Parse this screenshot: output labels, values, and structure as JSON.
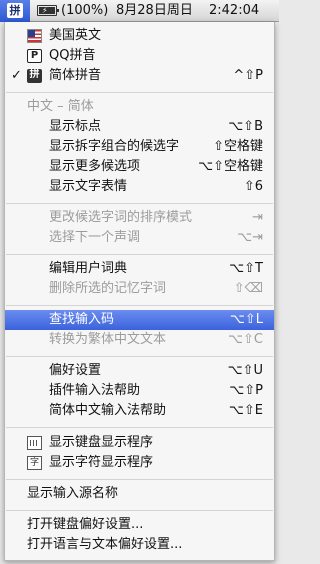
{
  "menubar": {
    "ime_glyph": "拼",
    "battery_glyph": "⚡",
    "battery": "(100%)",
    "date": "8月28日周日",
    "time": "2:42:04"
  },
  "menu": {
    "input_sources": [
      {
        "label": "美国英文",
        "icon": "us-flag-icon",
        "checked": false,
        "shortcut": ""
      },
      {
        "label": "QQ拼音",
        "icon": "p-box-icon",
        "icon_glyph": "P",
        "checked": false,
        "shortcut": ""
      },
      {
        "label": "简体拼音",
        "icon": "pinyin-icon",
        "icon_glyph": "拼",
        "checked": true,
        "check_glyph": "✓",
        "shortcut": "^⇧P"
      }
    ],
    "section_header": "中文 – 简体",
    "display_items": [
      {
        "label": "显示标点",
        "shortcut": "⌥⇧B"
      },
      {
        "label": "显示拆字组合的候选字",
        "shortcut": "⇧空格键"
      },
      {
        "label": "显示更多候选项",
        "shortcut": "⌥⇧空格键"
      },
      {
        "label": "显示文字表情",
        "shortcut": "⇧6"
      }
    ],
    "candidate_items": [
      {
        "label": "更改候选字词的排序模式",
        "shortcut": "⇥"
      },
      {
        "label": "选择下一个声调",
        "shortcut": "⌥⇥"
      }
    ],
    "dictionary_items": [
      {
        "label": "编辑用户词典",
        "shortcut": "⌥⇧T"
      },
      {
        "label": "删除所选的记忆字词",
        "shortcut": "⇧⌫"
      }
    ],
    "search_items": [
      {
        "label": "查找输入码",
        "shortcut": "⌥⇧L"
      },
      {
        "label": "转换为繁体中文文本",
        "shortcut": "⌥⇧C"
      }
    ],
    "pref_items": [
      {
        "label": "偏好设置",
        "shortcut": "⌥⇧U"
      },
      {
        "label": "插件输入法帮助",
        "shortcut": "⌥⇧P"
      },
      {
        "label": "简体中文输入法帮助",
        "shortcut": "⌥⇧E"
      }
    ],
    "viewer_items": [
      {
        "label": "显示键盘显示程序",
        "icon": "keyboard-viewer-icon"
      },
      {
        "label": "显示字符显示程序",
        "icon": "character-viewer-icon",
        "icon_glyph": "字"
      }
    ],
    "show_source_name": "显示输入源名称",
    "open_keyboard_prefs": "打开键盘偏好设置...",
    "open_language_prefs": "打开语言与文本偏好设置..."
  }
}
